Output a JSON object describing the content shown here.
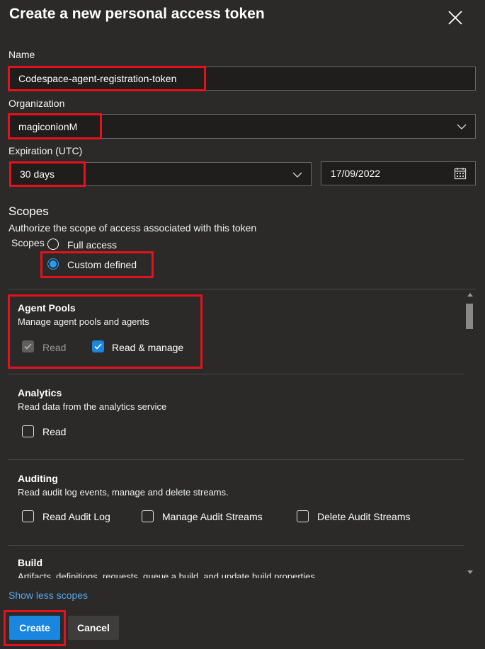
{
  "dialog": {
    "title": "Create a new personal access token"
  },
  "form": {
    "name_label": "Name",
    "name_value": "Codespace-agent-registration-token",
    "org_label": "Organization",
    "org_value": "magiconionM",
    "expiration_label": "Expiration (UTC)",
    "expiration_value": "30 days",
    "date_value": "17/09/2022"
  },
  "scopes": {
    "heading": "Scopes",
    "description": "Authorize the scope of access associated with this token",
    "scopes_label": "Scopes",
    "options": [
      {
        "label": "Full access",
        "selected": false
      },
      {
        "label": "Custom defined",
        "selected": true
      }
    ],
    "sections": [
      {
        "title": "Agent Pools",
        "description": "Manage agent pools and agents",
        "checks": [
          {
            "label": "Read",
            "checked": true,
            "disabled": true
          },
          {
            "label": "Read & manage",
            "checked": true,
            "disabled": false
          }
        ]
      },
      {
        "title": "Analytics",
        "description": "Read data from the analytics service",
        "checks": [
          {
            "label": "Read",
            "checked": false,
            "disabled": false
          }
        ]
      },
      {
        "title": "Auditing",
        "description": "Read audit log events, manage and delete streams.",
        "checks": [
          {
            "label": "Read Audit Log",
            "checked": false,
            "disabled": false
          },
          {
            "label": "Manage Audit Streams",
            "checked": false,
            "disabled": false
          },
          {
            "label": "Delete Audit Streams",
            "checked": false,
            "disabled": false
          }
        ]
      },
      {
        "title": "Build",
        "description": "Artifacts, definitions, requests, queue a build, and update build properties"
      }
    ],
    "show_less": "Show less scopes"
  },
  "footer": {
    "create_label": "Create",
    "cancel_label": "Cancel"
  },
  "colors": {
    "background": "#2b2a29",
    "accent": "#1a86e0",
    "link": "#57a8f0",
    "highlight": "#e3121e"
  }
}
